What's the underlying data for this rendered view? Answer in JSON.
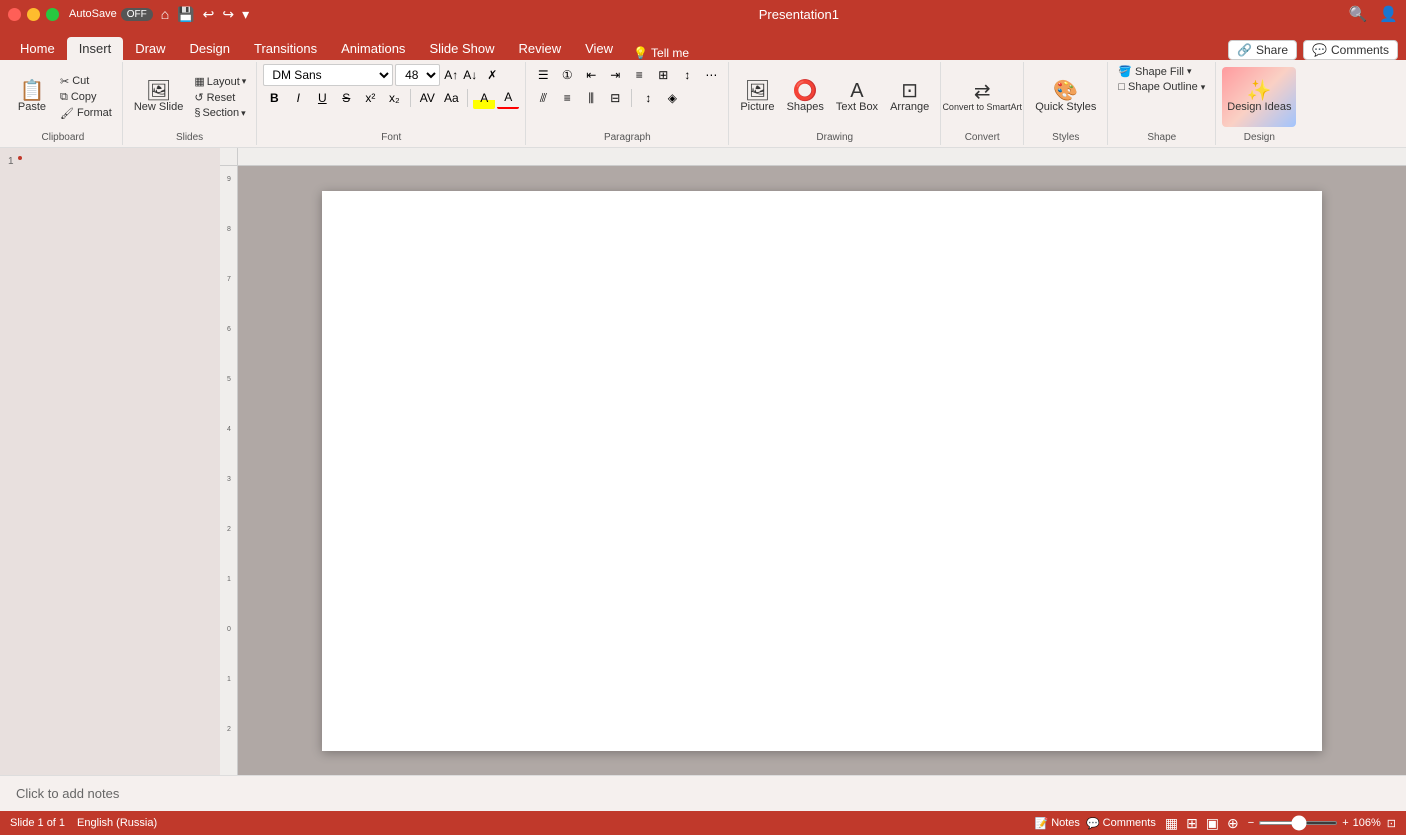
{
  "window": {
    "title": "Presentation1",
    "autosave": "AutoSave",
    "autosave_toggle": "OFF"
  },
  "tabs": {
    "items": [
      {
        "label": "Home",
        "active": false
      },
      {
        "label": "Insert",
        "active": true
      },
      {
        "label": "Draw",
        "active": false
      },
      {
        "label": "Design",
        "active": false
      },
      {
        "label": "Transitions",
        "active": false
      },
      {
        "label": "Animations",
        "active": false
      },
      {
        "label": "Slide Show",
        "active": false
      },
      {
        "label": "Review",
        "active": false
      },
      {
        "label": "View",
        "active": false
      }
    ],
    "tell_me": "Tell me",
    "share": "Share",
    "comments": "Comments"
  },
  "ribbon": {
    "clipboard": {
      "label": "Clipboard",
      "paste": "Paste",
      "cut": "Cut",
      "copy": "Copy",
      "format": "Format"
    },
    "slides": {
      "new_slide": "New Slide",
      "layout": "Layout",
      "reset": "Reset",
      "section": "Section"
    },
    "font": {
      "name": "DM Sans",
      "size": "48",
      "bold": "B",
      "italic": "I",
      "underline": "U",
      "strikethrough": "S",
      "superscript": "x²",
      "subscript": "x₂"
    },
    "paragraph": {
      "label": "Paragraph"
    },
    "drawing": {
      "shapes": "Shapes",
      "text_box": "Text Box",
      "arrange": "Arrange"
    },
    "insert_picture": {
      "label": "Picture"
    },
    "convert": {
      "label": "Convert to SmartArt"
    },
    "quick_styles": {
      "label": "Quick Styles"
    },
    "shape_fill": {
      "label": "Shape Fill"
    },
    "shape_outline": {
      "label": "Shape Outline"
    },
    "design_ideas": {
      "label": "Design Ideas"
    }
  },
  "slide": {
    "number": "1",
    "total": "1",
    "language": "English (Russia)"
  },
  "notes": {
    "placeholder": "Click to add notes"
  },
  "status": {
    "slide_info": "Slide 1 of 1",
    "language": "English (Russia)",
    "notes": "Notes",
    "comments": "Comments",
    "zoom": "106%"
  },
  "view_buttons": [
    {
      "icon": "▦",
      "name": "normal-view"
    },
    {
      "icon": "⊞",
      "name": "slide-sorter-view"
    },
    {
      "icon": "▣",
      "name": "reading-view"
    }
  ]
}
